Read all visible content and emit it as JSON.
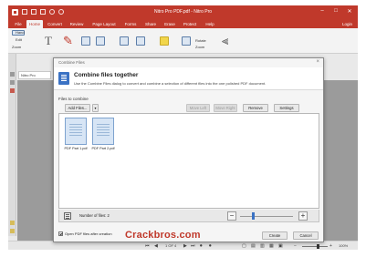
{
  "window": {
    "title": "Nitro Pro PDF.pdf - Nitro Pro",
    "controls": [
      "–",
      "□",
      "✕"
    ]
  },
  "ribbon_tabs": [
    "File",
    "Home",
    "Convert",
    "Review",
    "Page Layout",
    "Forms",
    "Share",
    "Erase",
    "Protect",
    "Help"
  ],
  "active_tab": "Home",
  "login": "Login",
  "ribbon": {
    "hand": "Hand",
    "edit": "Edit",
    "zoom": "Zoom",
    "rotate": "Rotate",
    "zoom2": "Zoom"
  },
  "doc_tab": "Nitro Pro",
  "dialog": {
    "title": "Combine Files",
    "close": "×",
    "header_title": "Combine files together",
    "header_desc": "Use the Combine Files dialog to convert and combine a selection of different files into the one polished PDF document.",
    "files_label": "Files to combine",
    "buttons": {
      "add_files": "Add Files...",
      "move_left": "Move Left",
      "move_right": "Move Right",
      "remove": "Remove",
      "settings": "Settings"
    },
    "files": [
      "PDF Part 1.pdf",
      "PDF Part 2.pdf"
    ],
    "count_label": "Number of files: 2",
    "zoom_out": "−",
    "zoom_in": "+",
    "slider_level": 0.22,
    "open_after": "Open PDF files after creation",
    "open_after_checked": true,
    "create": "Create",
    "cancel": "Cancel"
  },
  "watermark": "Crackbros.com",
  "status": {
    "page": "1 OF 4",
    "zoom": "100%",
    "slider_level": 0.6
  },
  "colors": {
    "accent": "#c0392b",
    "file_blue": "#3a72c4"
  }
}
